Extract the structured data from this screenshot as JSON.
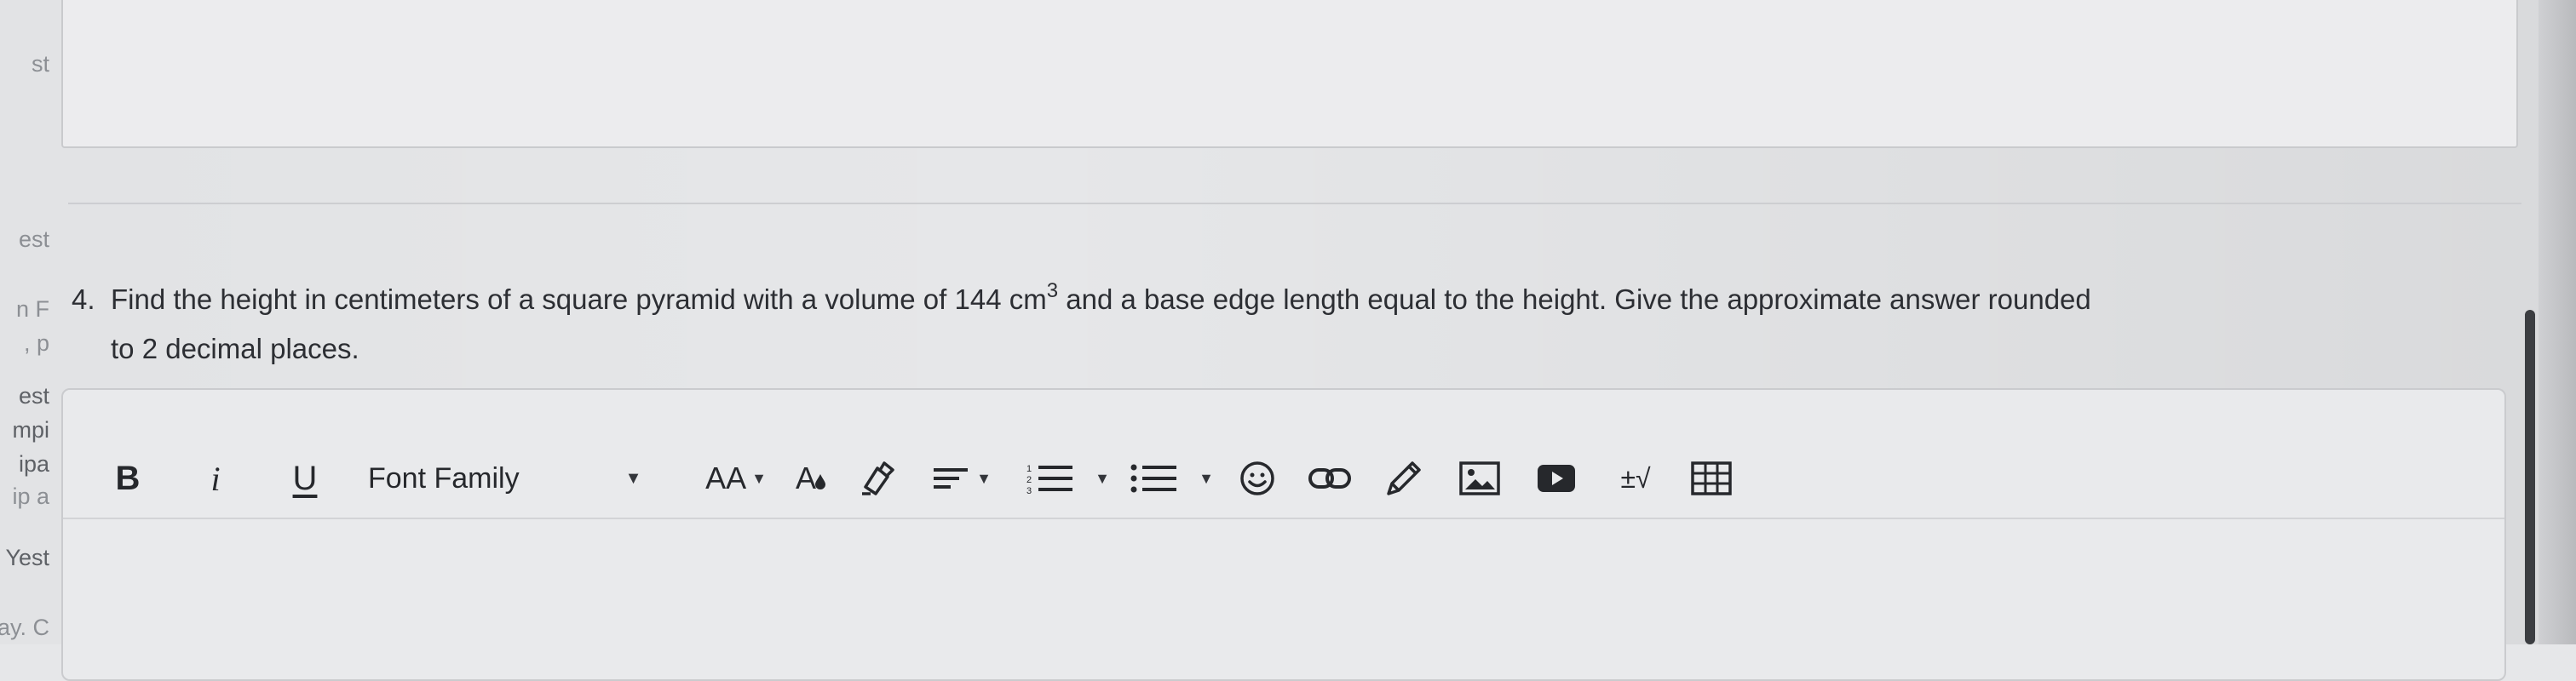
{
  "sidebar_fragments": [
    "st",
    "est",
    "n F",
    ", p",
    "est",
    "mpi",
    "ipa",
    "ip a",
    "Yest",
    "ay. C"
  ],
  "question": {
    "number": "4.",
    "line1_before_unit": "Find the height in centimeters of a square pyramid with a volume of 144 cm",
    "unit_exponent": "3",
    "line1_after_unit": " and a base edge length equal to the height. Give the approximate answer rounded",
    "line2": "to 2 decimal places."
  },
  "editor": {
    "toolbar": {
      "bold_label": "B",
      "italic_label": "i",
      "underline_label": "U",
      "font_family_label": "Font Family",
      "font_size_label": "AA",
      "text_color_label": "A",
      "math_label": "±√"
    },
    "content": ""
  },
  "icons": {
    "bold": "bold-icon",
    "italic": "italic-icon",
    "underline": "underline-icon",
    "font_size": "font-size-icon",
    "text_color": "text-color-icon",
    "highlight": "highlight-icon",
    "align": "align-icon",
    "ordered_list": "ordered-list-icon",
    "unordered_list": "unordered-list-icon",
    "emoji": "emoji-icon",
    "link": "link-icon",
    "draw": "pencil-icon",
    "image": "image-icon",
    "video": "video-icon",
    "math": "math-icon",
    "table": "table-icon"
  },
  "colors": {
    "background": "#e6e7e9",
    "text": "#2b2d31",
    "border": "#cacbce"
  }
}
